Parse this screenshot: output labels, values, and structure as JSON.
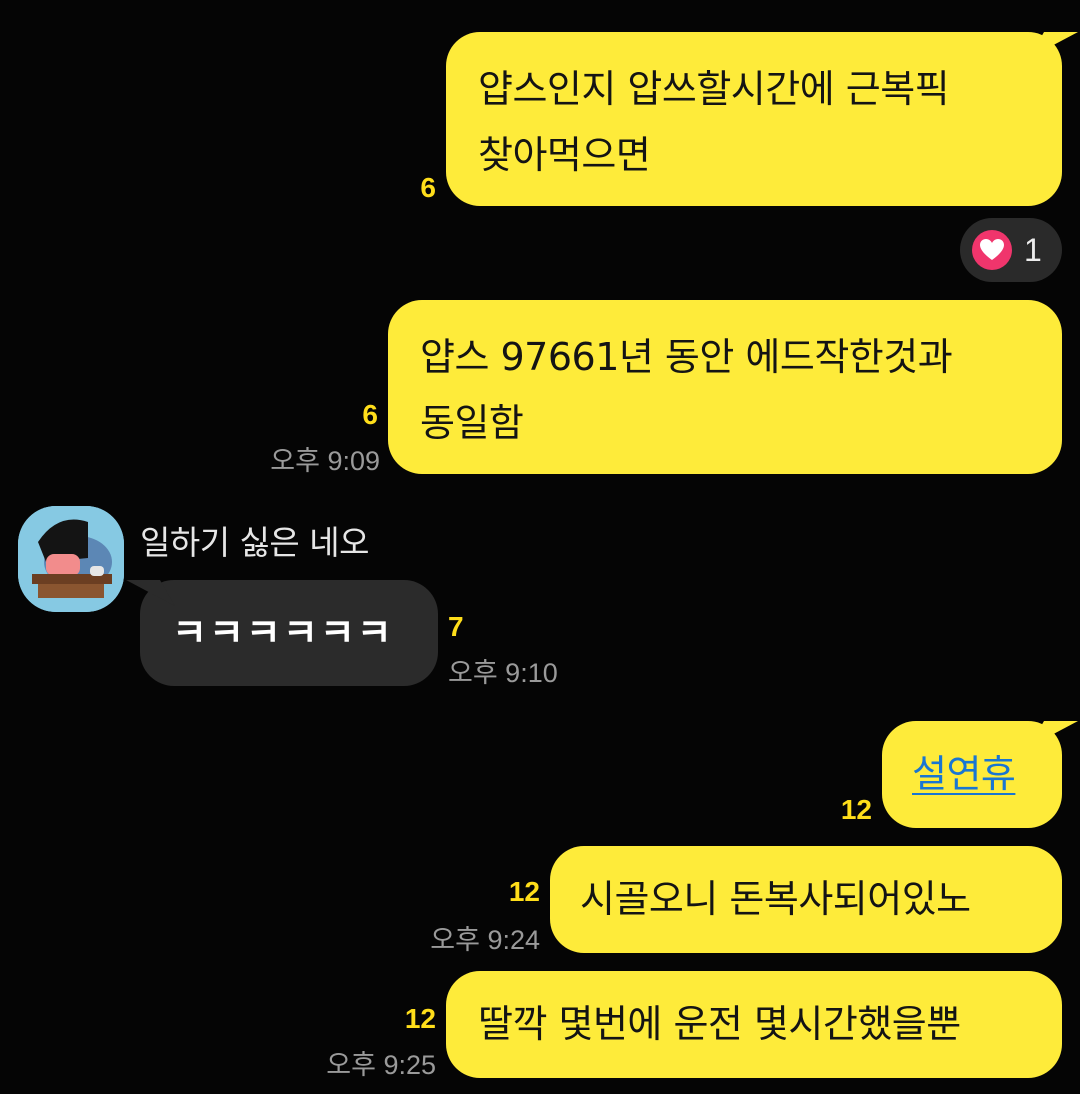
{
  "messages": [
    {
      "text_line1": "얍스인지 압쓰할시간에 근복픽",
      "text_line2": "찾아먹으면",
      "unread": "6"
    },
    {
      "reaction": {
        "icon": "heart-icon",
        "count": "1"
      }
    },
    {
      "text_line1": "얍스 97661년 동안 에드작한것과",
      "text_line2": "동일함",
      "unread": "6",
      "time": "오후 9:09"
    },
    {
      "sender": "일하기 싫은 네오",
      "text": "ㅋㅋㅋㅋㅋㅋ",
      "unread": "7",
      "time": "오후 9:10"
    },
    {
      "text": "설연휴",
      "unread": "12",
      "is_link": true
    },
    {
      "text": "시골오니 돈복사되어있노",
      "unread": "12",
      "time": "오후 9:24"
    },
    {
      "text": "딸깍 몇번에 운전 몇시간했을뿐",
      "unread": "12",
      "time": "오후 9:25"
    }
  ],
  "colors": {
    "background": "#050505",
    "my_bubble": "#FEEB3A",
    "other_bubble": "#2B2B2B",
    "unread_count": "#FFDE1A",
    "timestamp": "#9A9A9A",
    "reaction_heart": "#F0356C",
    "link": "#1976D2"
  }
}
